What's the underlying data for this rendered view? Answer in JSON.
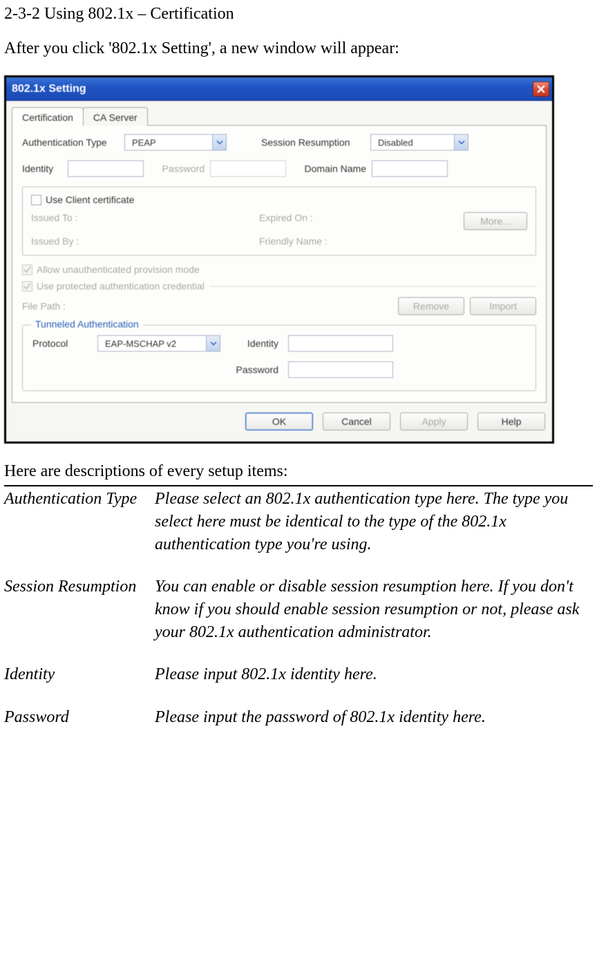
{
  "doc": {
    "section_title": "2-3-2 Using 802.1x – Certification",
    "intro": "After you click '802.1x Setting', a new window will appear:",
    "desc_head": "Here are descriptions of every setup items:"
  },
  "dialog": {
    "title": "802.1x Setting",
    "tabs": {
      "certification": "Certification",
      "ca_server": "CA Server"
    },
    "auth_type_label": "Authentication Type",
    "auth_type_value": "PEAP",
    "session_resumption_label": "Session Resumption",
    "session_resumption_value": "Disabled",
    "identity_label": "Identity",
    "identity_value": "",
    "password_label": "Password",
    "password_value": "",
    "domain_name_label": "Domain Name",
    "domain_name_value": "",
    "use_client_cert_label": "Use Client certificate",
    "issued_to_label": "Issued To :",
    "expired_on_label": "Expired On :",
    "issued_by_label": "Issued By :",
    "friendly_name_label": "Friendly Name :",
    "more_btn": "More...",
    "allow_unauth_label": "Allow unauthenticated provision mode",
    "use_protected_label": "Use protected authentication credential",
    "file_path_label": "File Path :",
    "remove_btn": "Remove",
    "import_btn": "Import",
    "tunneled_legend": "Tunneled Authentication",
    "protocol_label": "Protocol",
    "protocol_value": "EAP-MSCHAP v2",
    "ta_identity_label": "Identity",
    "ta_identity_value": "",
    "ta_password_label": "Password",
    "ta_password_value": "",
    "ok_btn": "OK",
    "cancel_btn": "Cancel",
    "apply_btn": "Apply",
    "help_btn": "Help"
  },
  "descriptions": [
    {
      "term": "Authentication Type",
      "def": "Please select an 802.1x authentication type here. The type you select here must be identical to the type of the 802.1x authentication type you're using."
    },
    {
      "term": "Session Resumption",
      "def": "You can enable or disable session resumption here. If you don't know if you should enable session resumption or not, please ask your 802.1x authentication administrator."
    },
    {
      "term": "Identity",
      "def": "Please input 802.1x identity here."
    },
    {
      "term": "Password",
      "def": "Please input the password of 802.1x identity here."
    }
  ]
}
